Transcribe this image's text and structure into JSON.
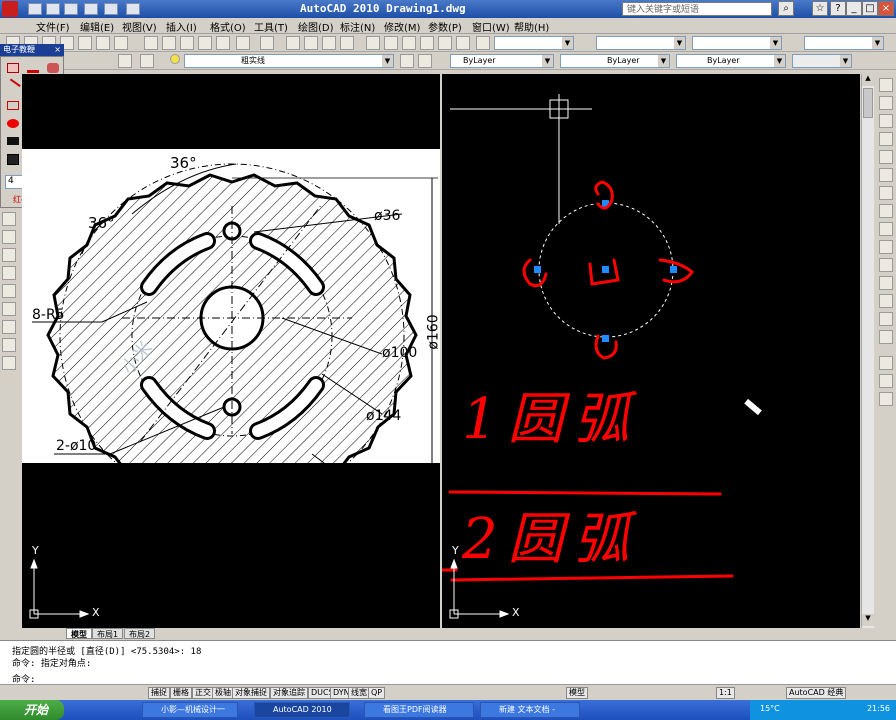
{
  "window": {
    "title": "AutoCAD 2010  Drawing1.dwg",
    "search_placeholder": "键入关键字或短语"
  },
  "menu": [
    "文件(F)",
    "编辑(E)",
    "视图(V)",
    "插入(I)",
    "格式(O)",
    "工具(T)",
    "绘图(D)",
    "标注(N)",
    "修改(M)",
    "参数(P)",
    "窗口(W)",
    "帮助(H)"
  ],
  "properties": {
    "linetype_name": "粗实线",
    "layer": "ByLayer",
    "linetype": "ByLayer",
    "lineweight": "ByLayer"
  },
  "pen_panel": {
    "title": "电子教鞭",
    "size_value": "4",
    "brand": "红袖软件"
  },
  "drawing": {
    "dims": {
      "angle_top": "36°",
      "angle_left": "36°",
      "d36": "ø36",
      "d160": "ø160",
      "d100": "ø100",
      "d144": "ø144",
      "r5": "8-R5",
      "d10": "2-ø10"
    },
    "watermark": "小米",
    "ucs_x": "X",
    "ucs_y": "Y"
  },
  "annotations": {
    "line1": "1圆弧",
    "line2": "2圆弧"
  },
  "tabs": [
    "模型",
    "布局1",
    "布局2"
  ],
  "command": {
    "line1": "指定圆的半径或 [直径(D)] <75.5304>: 18",
    "line2": "命令: 指定对角点:",
    "prompt": "命令:"
  },
  "status": {
    "buttons": [
      "捕捉",
      "栅格",
      "正交",
      "极轴",
      "对象捕捉",
      "对象追踪",
      "DUCS",
      "DYN",
      "线宽",
      "QP"
    ],
    "model": "模型",
    "scale": "1:1",
    "workspace": "AutoCAD 经典"
  },
  "taskbar": {
    "start": "开始",
    "tasks": [
      "小影—机械设计一",
      "AutoCAD 2010",
      "看图王PDF阅读器",
      "新建 文本文档 -"
    ],
    "temperature": "15°C",
    "time": "21:56"
  }
}
